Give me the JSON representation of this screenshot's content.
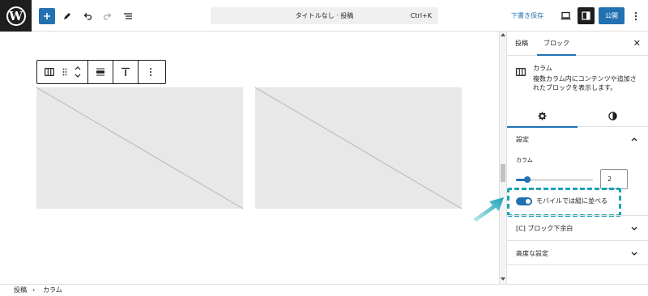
{
  "topbar": {
    "doc_title": "タイトルなし · 投稿",
    "shortcut": "Ctrl+K",
    "save_draft": "下書き保存",
    "publish": "公開"
  },
  "sidebar": {
    "tabs": {
      "post": "投稿",
      "block": "ブロック"
    },
    "close": "✕",
    "block_card": {
      "name": "カラム",
      "description": "複数カラム内にコンテンツや追加されたブロックを表示します。"
    },
    "settings_panel": {
      "title": "設定",
      "columns_label": "カラム",
      "columns_value": "2",
      "columns_range_fraction": 0.15,
      "stack_mobile_label": "モバイルでは縦に並べる",
      "stack_mobile_on": true
    },
    "panels": {
      "bottom_margin": "[C] ブロック下余白",
      "advanced": "高度な設定"
    }
  },
  "breadcrumb": {
    "items": [
      "投稿",
      "カラム"
    ],
    "separator": "›"
  },
  "colors": {
    "accent": "#2271b1",
    "highlight": "#1aa3b8",
    "placeholder": "#e8e8e8"
  }
}
